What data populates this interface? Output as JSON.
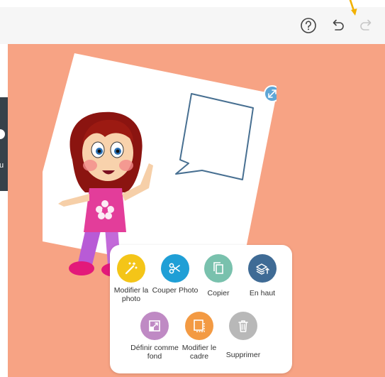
{
  "colors": {
    "canvas": "#f7a384",
    "toolbar": "#f6f6f6",
    "accent_arrow": "#f2b100",
    "resize_handle": "#5ea6d6"
  },
  "toolbar": {
    "help_icon": "help-circle-icon",
    "undo_icon": "undo-icon",
    "redo_icon": "redo-icon"
  },
  "side_panel": {
    "letter": "u"
  },
  "menu": {
    "row1": [
      {
        "label": "Modifier la photo",
        "icon": "magic-wand-icon",
        "color": "#f4c518"
      },
      {
        "label": "Couper Photo",
        "icon": "scissors-icon",
        "color": "#1f9fd6"
      },
      {
        "label": "Copier",
        "icon": "copy-icon",
        "color": "#79c1ad"
      },
      {
        "label": "En haut",
        "icon": "layers-up-icon",
        "color": "#3f6b95"
      }
    ],
    "row2": [
      {
        "label": "Définir comme fond",
        "icon": "set-background-icon",
        "color": "#bf8ac4"
      },
      {
        "label": "Modifier le cadre",
        "icon": "frame-icon",
        "color": "#f39a43"
      },
      {
        "label": "Supprimer",
        "icon": "trash-icon",
        "color": "#b8b8b8"
      }
    ]
  }
}
